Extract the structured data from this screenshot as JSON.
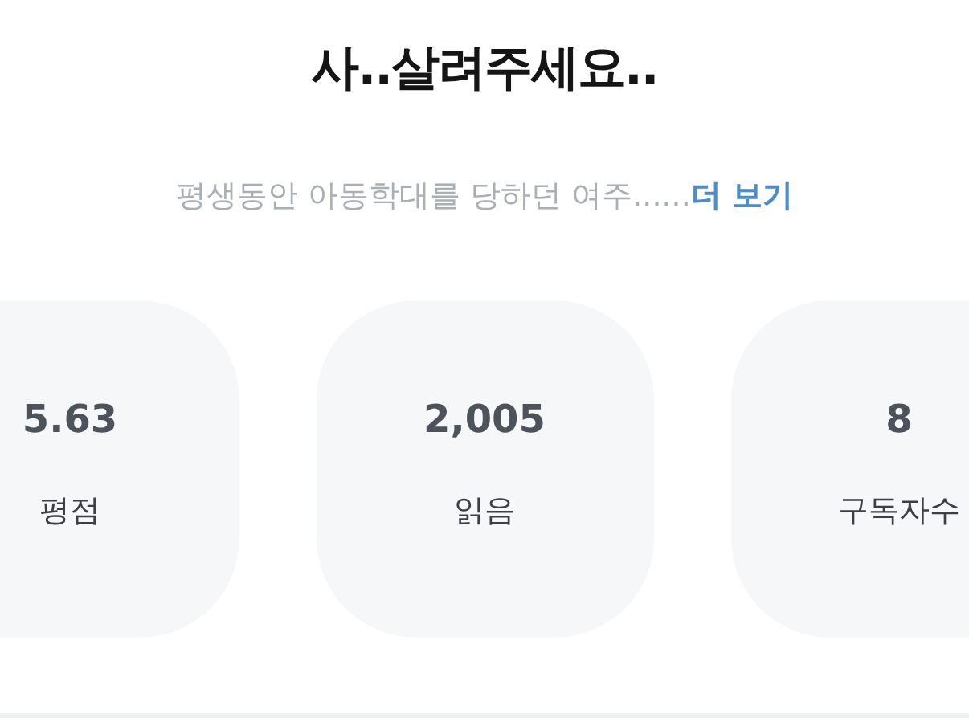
{
  "title": "사..살려주세요..",
  "synopsis": {
    "text": "평생동안 아동학대를 당하던 여주......",
    "more_link": "더 보기"
  },
  "stats": [
    {
      "value": "5.63",
      "label": "평점"
    },
    {
      "value": "2,005",
      "label": "읽음"
    },
    {
      "value": "8",
      "label": "구독자수"
    }
  ]
}
